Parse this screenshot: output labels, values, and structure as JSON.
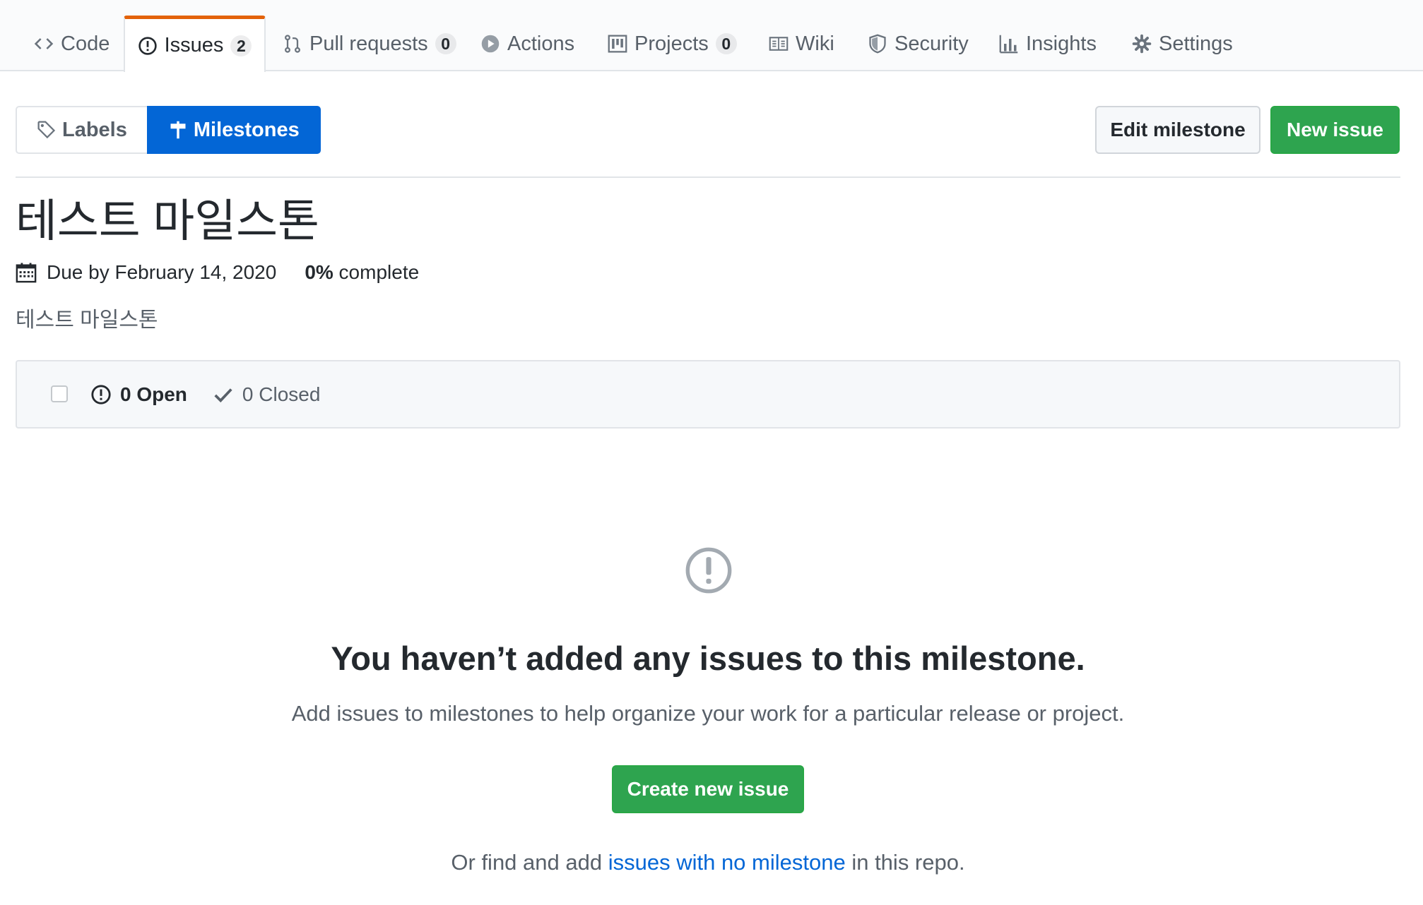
{
  "repo_nav": {
    "tabs": [
      {
        "label": "Code",
        "icon": "code-icon"
      },
      {
        "label": "Issues",
        "icon": "issue-opened-icon",
        "count": "2",
        "selected": true
      },
      {
        "label": "Pull requests",
        "icon": "git-pull-request-icon",
        "count": "0"
      },
      {
        "label": "Actions",
        "icon": "play-icon"
      },
      {
        "label": "Projects",
        "icon": "project-icon",
        "count": "0"
      },
      {
        "label": "Wiki",
        "icon": "book-icon"
      },
      {
        "label": "Security",
        "icon": "shield-icon"
      },
      {
        "label": "Insights",
        "icon": "graph-icon"
      },
      {
        "label": "Settings",
        "icon": "gear-icon"
      }
    ]
  },
  "subnav": {
    "labels": "Labels",
    "milestones": "Milestones"
  },
  "actions": {
    "edit_milestone": "Edit milestone",
    "new_issue": "New issue"
  },
  "milestone": {
    "title": "테스트 마일스톤",
    "due": "Due by February 14, 2020",
    "percent": "0%",
    "complete_label": " complete",
    "description": "테스트 마일스톤"
  },
  "issues_header": {
    "open": "0 Open",
    "closed": "0 Closed"
  },
  "blankslate": {
    "title": "You haven’t added any issues to this milestone.",
    "text": "Add issues to milestones to help organize your work for a particular release or project.",
    "button": "Create new issue",
    "footer_before": "Or find and add ",
    "footer_link": "issues with no milestone",
    "footer_after": " in this repo."
  },
  "colors": {
    "accent_blue": "#0366d6",
    "primary_green": "#2ea44f",
    "tab_highlight": "#e36209"
  }
}
